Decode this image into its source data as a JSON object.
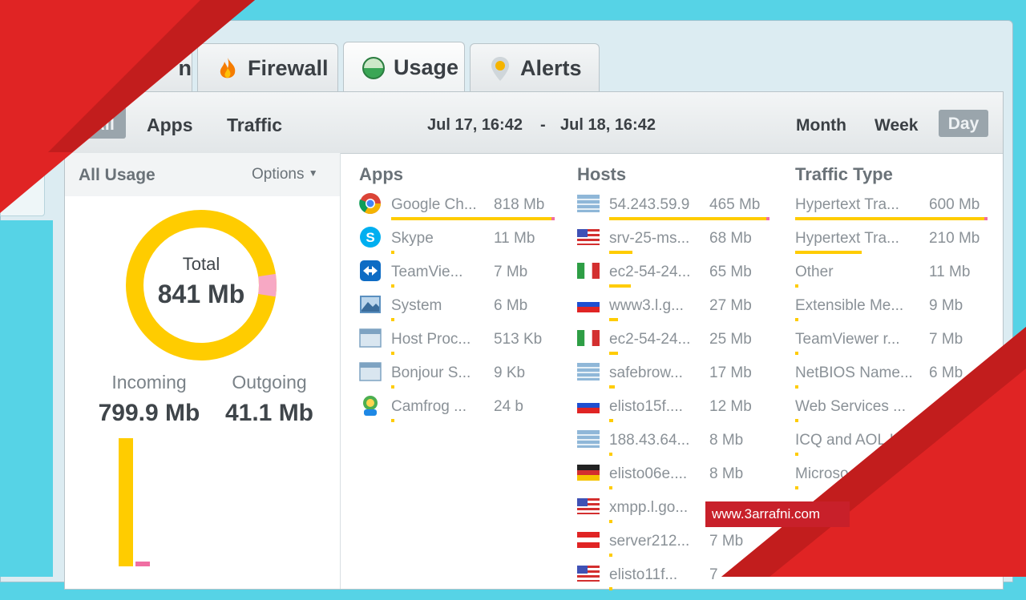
{
  "tabs": [
    {
      "label": "n",
      "icon": "tab-icon"
    },
    {
      "label": "Firewall",
      "icon": "flame-icon"
    },
    {
      "label": "Usage",
      "icon": "usage-icon"
    },
    {
      "label": "Alerts",
      "icon": "pin-icon"
    }
  ],
  "toolbar": {
    "all_label": "All",
    "apps_label": "Apps",
    "traffic_label": "Traffic",
    "range_start": "Jul 17, 16:42",
    "range_sep": "-",
    "range_end": "Jul 18, 16:42",
    "month_label": "Month",
    "week_label": "Week",
    "day_label": "Day"
  },
  "sidebar": {
    "title": "All Usage",
    "options_label": "Options",
    "total_label": "Total",
    "total_value": "841 Mb",
    "incoming_label": "Incoming",
    "incoming_value": "799.9 Mb",
    "outgoing_label": "Outgoing",
    "outgoing_value": "41.1 Mb",
    "incoming_fraction": 0.951
  },
  "columns": {
    "apps": {
      "title": "Apps",
      "rows": [
        {
          "name": "Google Ch...",
          "value": "818 Mb",
          "icon": "chrome-icon",
          "fraction": 1.0
        },
        {
          "name": "Skype",
          "value": "11 Mb",
          "icon": "skype-icon",
          "fraction": 0.013
        },
        {
          "name": "TeamVie...",
          "value": "7 Mb",
          "icon": "teamviewer-icon",
          "fraction": 0.009
        },
        {
          "name": "System",
          "value": "6 Mb",
          "icon": "system-icon",
          "fraction": 0.007
        },
        {
          "name": "Host Proc...",
          "value": "513 Kb",
          "icon": "window-icon",
          "fraction": 0.001
        },
        {
          "name": "Bonjour S...",
          "value": "9 Kb",
          "icon": "window-icon",
          "fraction": 0.001
        },
        {
          "name": "Camfrog ...",
          "value": "24 b",
          "icon": "camfrog-icon",
          "fraction": 0.001
        }
      ]
    },
    "hosts": {
      "title": "Hosts",
      "rows": [
        {
          "name": "54.243.59.9",
          "value": "465 Mb",
          "icon": "server-icon",
          "fraction": 1.0
        },
        {
          "name": "srv-25-ms...",
          "value": "68 Mb",
          "icon": "flag-us-icon",
          "fraction": 0.146
        },
        {
          "name": "ec2-54-24...",
          "value": "65 Mb",
          "icon": "flag-it-icon",
          "fraction": 0.14
        },
        {
          "name": "www3.l.g...",
          "value": "27 Mb",
          "icon": "flag-ru-icon",
          "fraction": 0.058
        },
        {
          "name": "ec2-54-24...",
          "value": "25 Mb",
          "icon": "flag-it-icon",
          "fraction": 0.054
        },
        {
          "name": "safebrow...",
          "value": "17 Mb",
          "icon": "server-icon",
          "fraction": 0.037
        },
        {
          "name": "elisto15f....",
          "value": "12 Mb",
          "icon": "flag-ru-icon",
          "fraction": 0.026
        },
        {
          "name": "188.43.64...",
          "value": "8 Mb",
          "icon": "server-icon",
          "fraction": 0.017
        },
        {
          "name": "elisto06e....",
          "value": "8 Mb",
          "icon": "flag-de-icon",
          "fraction": 0.017
        },
        {
          "name": "xmpp.l.go...",
          "value": "",
          "icon": "flag-us-icon",
          "fraction": 0.012
        },
        {
          "name": "server212...",
          "value": "7 Mb",
          "icon": "flag-at-icon",
          "fraction": 0.015
        },
        {
          "name": "elisto11f...",
          "value": "7",
          "icon": "flag-us-icon",
          "fraction": 0.015
        }
      ]
    },
    "traffic": {
      "title": "Traffic Type",
      "rows": [
        {
          "name": "Hypertext Tra...",
          "value": "600 Mb",
          "fraction": 1.0
        },
        {
          "name": "Hypertext Tra...",
          "value": "210 Mb",
          "fraction": 0.35
        },
        {
          "name": "Other",
          "value": "11 Mb",
          "fraction": 0.018
        },
        {
          "name": "Extensible Me...",
          "value": "9 Mb",
          "fraction": 0.015
        },
        {
          "name": "TeamViewer r...",
          "value": "7 Mb",
          "fraction": 0.012
        },
        {
          "name": "NetBIOS Name...",
          "value": "6 Mb",
          "fraction": 0.01
        },
        {
          "name": "Web Services ...",
          "value": "",
          "fraction": 0.005
        },
        {
          "name": "ICQ and AOL I...",
          "value": "",
          "fraction": 0.005
        },
        {
          "name": "Microso...",
          "value": "",
          "fraction": 0.005
        }
      ]
    }
  },
  "watermark": "www.3arrafni.com",
  "colors": {
    "accent": "#ffcc00",
    "secondary": "#f06ea2",
    "banner": "#e02424"
  }
}
